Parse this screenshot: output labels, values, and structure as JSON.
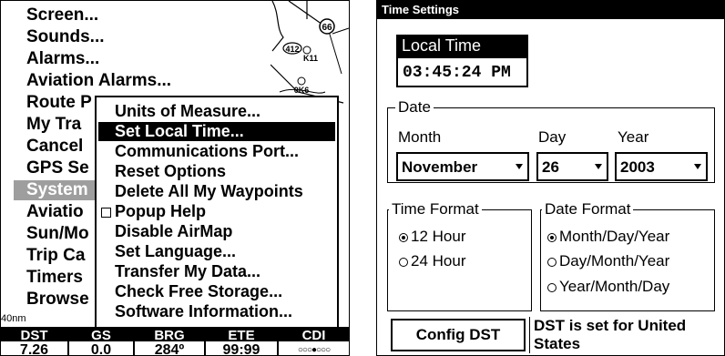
{
  "left": {
    "menu_items": [
      "Screen...",
      "Sounds...",
      "Alarms...",
      "Aviation Alarms...",
      "Route P",
      "My Tra",
      "Cancel",
      "GPS Se",
      "System",
      "Aviatio",
      "Sun/Mo",
      "Trip Ca",
      "Timers",
      "Browse"
    ],
    "selected_index": 8,
    "submenu_items": [
      "Units of Measure...",
      "Set Local Time...",
      "Communications Port...",
      "Reset Options",
      "Delete All My Waypoints",
      "Popup Help",
      "Disable AirMap",
      "Set Language...",
      "Transfer My Data...",
      "Check Free Storage...",
      "Software Information..."
    ],
    "submenu_selected": 1,
    "submenu_checkbox_index": 5,
    "map_labels": [
      "66",
      "412",
      "K11",
      "0K6"
    ],
    "scale": "40nm",
    "status": [
      {
        "label": "DST",
        "value": "7.26"
      },
      {
        "label": "GS",
        "value": "0.0"
      },
      {
        "label": "BRG",
        "value": "284º"
      },
      {
        "label": "ETE",
        "value": "99:99"
      },
      {
        "label": "CDI",
        "value": "○○○●○○○"
      }
    ]
  },
  "right": {
    "title": "Time Settings",
    "local_time_label": "Local Time",
    "local_time_value": "03:45:24 PM",
    "date_legend": "Date",
    "month_label": "Month",
    "day_label": "Day",
    "year_label": "Year",
    "month_value": "November",
    "day_value": "26",
    "year_value": "2003",
    "time_format_legend": "Time Format",
    "time_options": [
      "12 Hour",
      "24 Hour"
    ],
    "time_selected": 0,
    "date_format_legend": "Date Format",
    "date_options": [
      "Month/Day/Year",
      "Day/Month/Year",
      "Year/Month/Day"
    ],
    "date_selected": 0,
    "config_dst_label": "Config DST",
    "dst_status": "DST is set for United States"
  }
}
